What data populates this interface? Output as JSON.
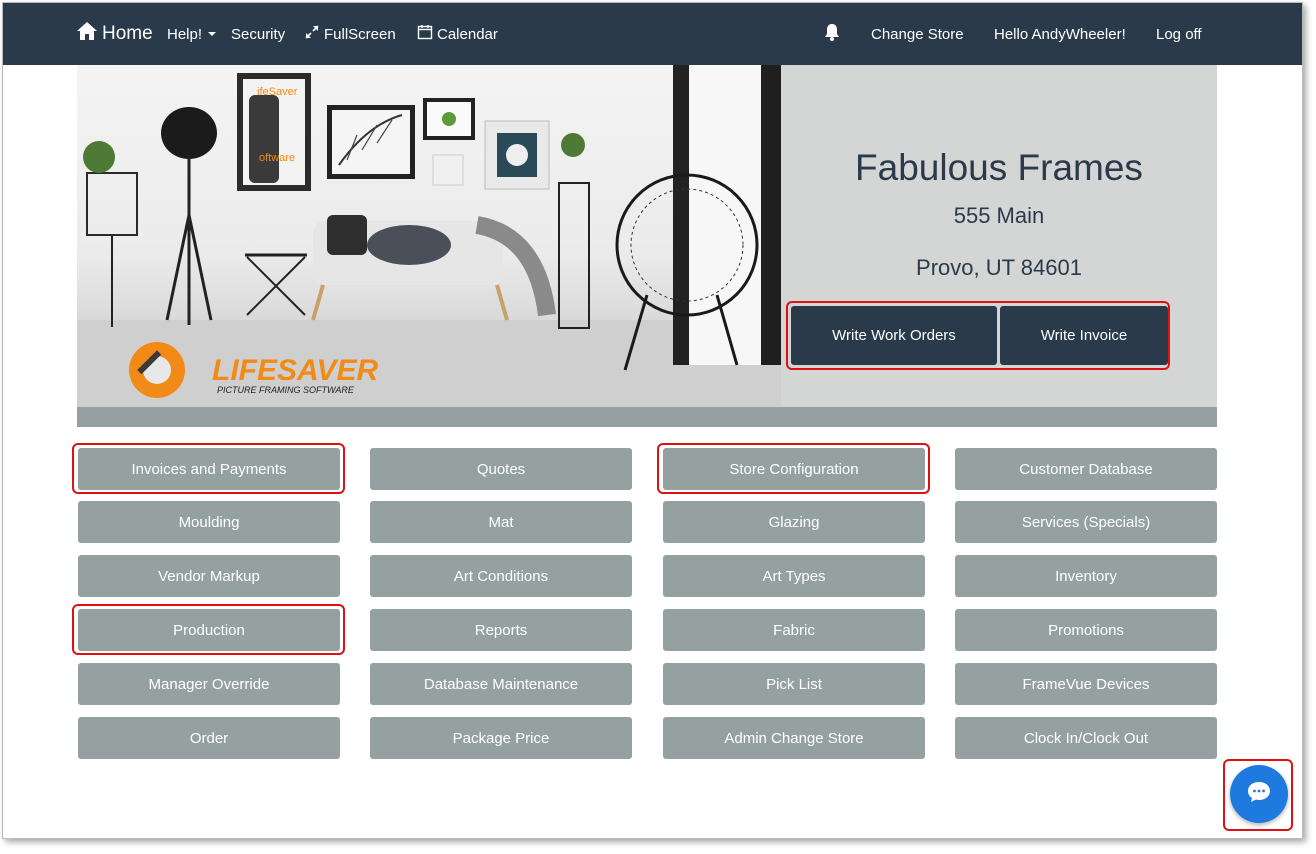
{
  "nav": {
    "home": "Home",
    "help": "Help!",
    "security": "Security",
    "fullscreen": "FullScreen",
    "calendar": "Calendar",
    "change_store": "Change Store",
    "hello": "Hello AndyWheeler!",
    "logoff": "Log off"
  },
  "hero": {
    "logo_text": "LIFESAVER",
    "logo_sub": "PICTURE FRAMING SOFTWARE",
    "wall_logo_line1": "ifeSaver",
    "wall_logo_line2": "oftware"
  },
  "store": {
    "name": "Fabulous Frames",
    "address1": "555 Main",
    "address2": "Provo, UT 84601"
  },
  "actions": {
    "work_orders": "Write Work Orders",
    "invoice": "Write Invoice"
  },
  "menu": [
    "Invoices and Payments",
    "Quotes",
    "Store Configuration",
    "Customer Database",
    "Moulding",
    "Mat",
    "Glazing",
    "Services (Specials)",
    "Vendor Markup",
    "Art Conditions",
    "Art Types",
    "Inventory",
    "Production",
    "Reports",
    "Fabric",
    "Promotions",
    "Manager Override",
    "Database Maintenance",
    "Pick List",
    "FrameVue Devices",
    "Order",
    "Package Price",
    "Admin Change Store",
    "Clock In/Clock Out"
  ],
  "colors": {
    "navbar": "#2b3a4a",
    "tile": "#95a1a1",
    "highlight": "#dd1111",
    "chat": "#1f7ae0"
  }
}
